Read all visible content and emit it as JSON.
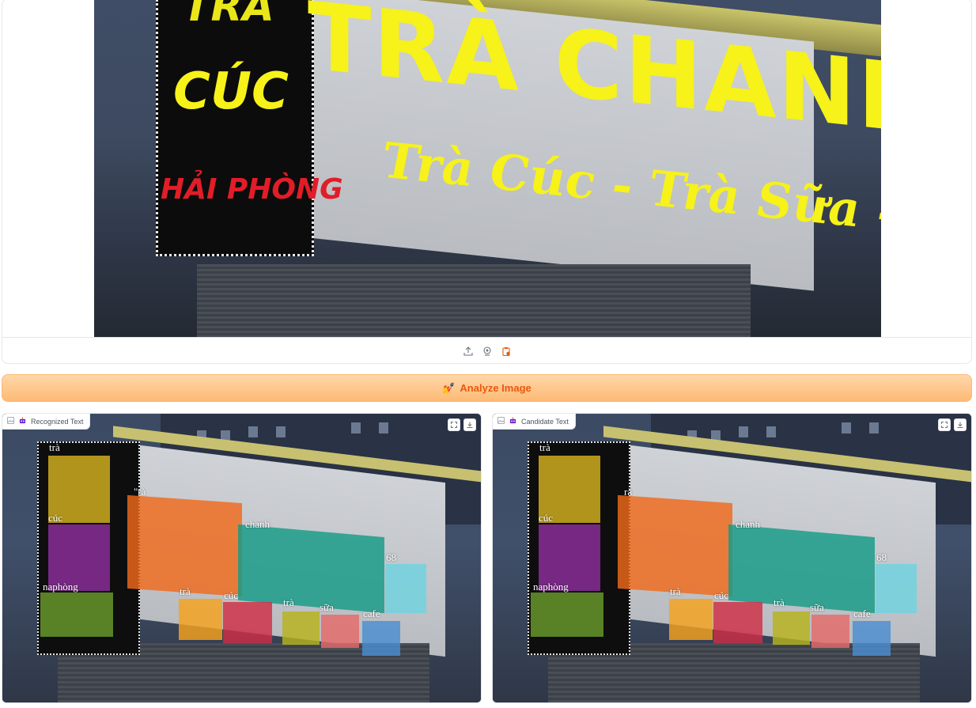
{
  "input": {
    "sign": {
      "main": "TRÀ CHANH 68",
      "sub": "Trà Cúc - Trà Sữa - Cafe",
      "left_top": "TRÀ",
      "left_mid": "CÚC",
      "left_bottom": "HẢI PHÒNG"
    }
  },
  "toolbar": {
    "upload_icon": "upload-icon",
    "webcam_icon": "webcam-icon",
    "clipboard_icon": "clipboard-icon"
  },
  "analyze_button": {
    "emoji": "💅",
    "label": "Analyze Image"
  },
  "outputs": [
    {
      "label": "Recognized Text",
      "words": [
        "trà",
        "\"rà",
        "cúc",
        "chanh",
        "68",
        "naphòng",
        "trà",
        "cúc",
        "trà",
        "sữa",
        "cafe"
      ]
    },
    {
      "label": "Candidate Text",
      "words": [
        "trà",
        "rà",
        "cúc",
        "chanh",
        "68",
        "naphòng",
        "trà",
        "cúc",
        "trà",
        "sữa",
        "cafe"
      ]
    }
  ],
  "colors": {
    "accent_orange": "#ea580c",
    "neon_yellow": "#f6f21a",
    "neon_red": "#e11d28"
  }
}
